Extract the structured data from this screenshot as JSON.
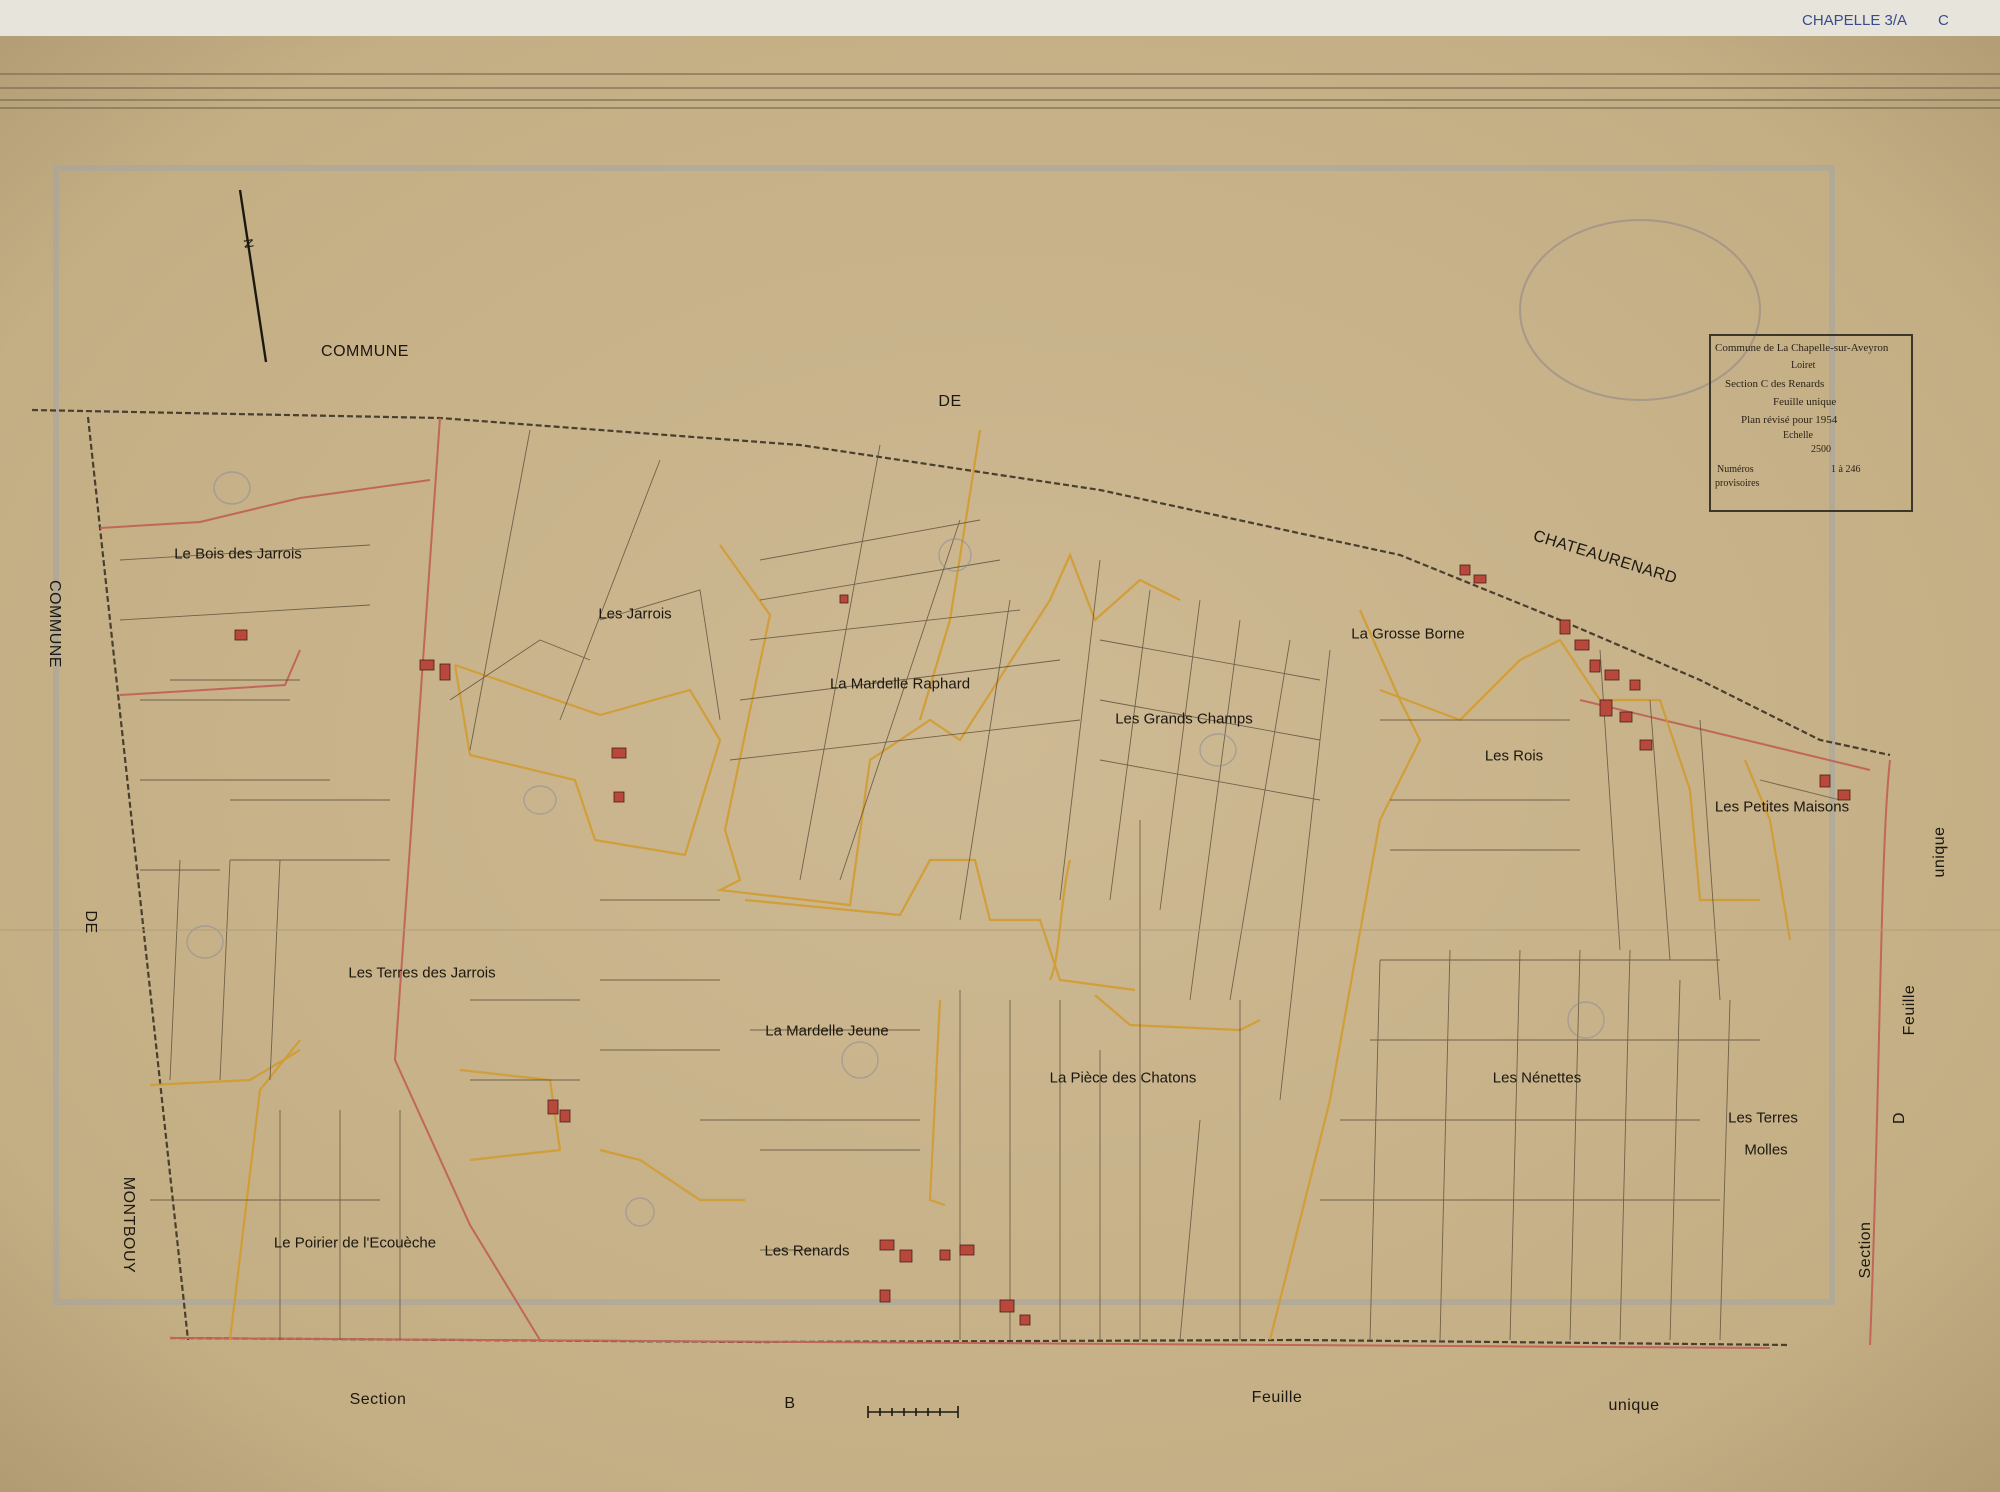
{
  "archive": {
    "reference": "CHAPELLE 3/A",
    "letter": "C"
  },
  "north_arrow": {
    "label": "N"
  },
  "border_labels": {
    "top_commune": "COMMUNE",
    "top_de": "DE",
    "top_chateaurenard": "CHATEAURENARD",
    "left_commune": "COMMUNE",
    "left_de": "DE",
    "left_montbouy": "MONTBOUY",
    "right_section": "Section",
    "right_d": "D",
    "right_feuille": "Feuille",
    "right_unique": "unique",
    "bottom_section": "Section",
    "bottom_b": "B",
    "bottom_feuille": "Feuille",
    "bottom_unique": "unique"
  },
  "places": [
    {
      "id": "bois-des-jarrois",
      "name": "Le Bois des Jarrois"
    },
    {
      "id": "les-jarrois",
      "name": "Les Jarrois"
    },
    {
      "id": "mardelle-raphard",
      "name": "La Mardelle Raphard"
    },
    {
      "id": "grands-champs",
      "name": "Les Grands Champs"
    },
    {
      "id": "grosse-borne",
      "name": "La Grosse Borne"
    },
    {
      "id": "les-rois",
      "name": "Les Rois"
    },
    {
      "id": "petites-maisons",
      "name": "Les Petites Maisons"
    },
    {
      "id": "terres-des-jarrois",
      "name": "Les Terres des Jarrois"
    },
    {
      "id": "mardelle-jeune",
      "name": "La Mardelle Jeune"
    },
    {
      "id": "piece-des-chatons",
      "name": "La Pièce des Chatons"
    },
    {
      "id": "nenettes",
      "name": "Les Nénettes"
    },
    {
      "id": "terres-molles-1",
      "name": "Les Terres"
    },
    {
      "id": "terres-molles-2",
      "name": "Molles"
    },
    {
      "id": "poirier",
      "name": "Le Poirier de l'Ecouèche"
    },
    {
      "id": "renards",
      "name": "Les Renards"
    }
  ],
  "cartouche": {
    "commune_line": "Commune de La Chapelle-sur-Aveyron",
    "department": "Loiret",
    "section_line": "Section C des Renards",
    "feuille": "Feuille unique",
    "plan_line": "Plan révisé pour 1954",
    "echelle_label": "Echelle",
    "scale": "2500",
    "numeros": "Numéros",
    "provisoires": "provisoires",
    "range": "1 à 246"
  },
  "colors": {
    "paper": "#c9b48c",
    "ink": "#2a2418",
    "boundary_red": "#c0675a",
    "parcel_orange": "#d39a2a",
    "building_red": "#b8483c"
  }
}
